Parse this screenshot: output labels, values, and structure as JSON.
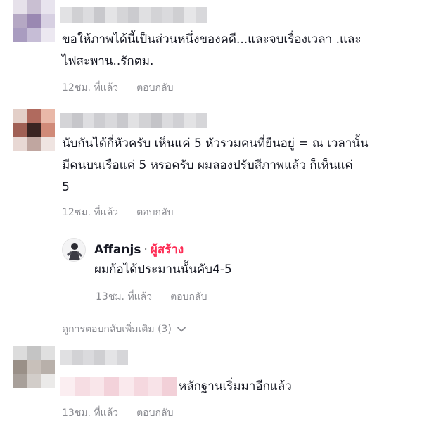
{
  "comments": [
    {
      "text_lines": [
        "ขอให้ภาพได้นี้เป็นส่วนหนึ่งของคดี...และจบเรื่องเวลา .และ",
        "ไฟสะพาน..รักตม."
      ],
      "time": "12ชม. ที่แล้ว",
      "reply_label": "ตอบกลับ"
    },
    {
      "text_lines": [
        "นับกันได้กี่หัวครับ เห็นแค่ 5 หัวรวมคนที่ยืนอยู่ = ณ เวลานั้น",
        "มีคนบนเรือแค่ 5 หรอครับ ผมลองปรับสีภาพแล้ว ก็เห็นแค่",
        "5"
      ],
      "time": "12ชม. ที่แล้ว",
      "reply_label": "ตอบกลับ",
      "reply": {
        "author": "Affanjs",
        "separator": "·",
        "badge": "ผู้สร้าง",
        "text": "ผมก้อได้ประมานนั้นคับ4-5",
        "time": "13ชม. ที่แล้ว",
        "reply_label": "ตอบกลับ"
      },
      "view_more": "ดูการตอบกลับเพิ่มเติม (3)"
    },
    {
      "text": "หลักฐานเริ่มมาอีกแล้ว",
      "time": "13ชม. ที่แล้ว",
      "reply_label": "ตอบกลับ"
    }
  ],
  "colors": {
    "text": "#161823",
    "meta": "#8a8b91",
    "creator_badge": "#fe2c55"
  },
  "icons": [
    "chevron-down-icon"
  ]
}
